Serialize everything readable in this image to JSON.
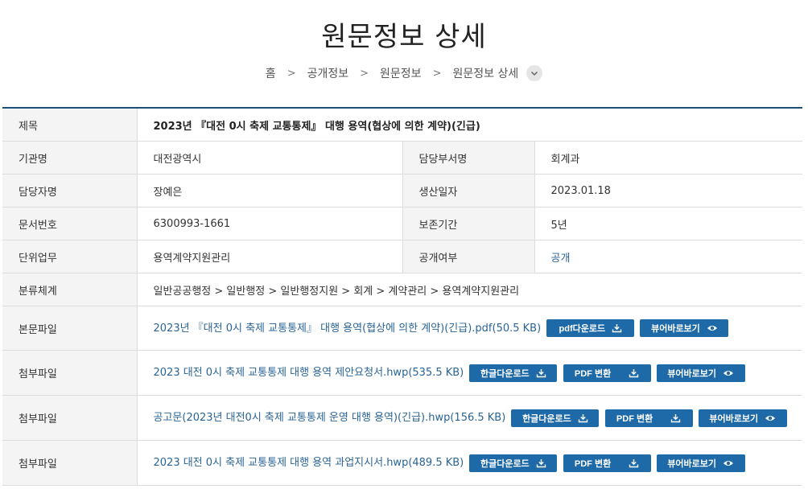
{
  "page": {
    "title": "원문정보 상세"
  },
  "breadcrumb": {
    "items": [
      "홈",
      "공개정보",
      "원문정보",
      "원문정보 상세"
    ],
    "separator": ">"
  },
  "detail": {
    "title_label": "제목",
    "title_value": "2023년 『대전 0시 축제 교통통제』 대행 용역(협상에 의한 계약)(긴급)",
    "rows": [
      {
        "label1": "기관명",
        "value1": "대전광역시",
        "label2": "담당부서명",
        "value2": "회계과"
      },
      {
        "label1": "담당자명",
        "value1": "장예은",
        "label2": "생산일자",
        "value2": "2023.01.18"
      },
      {
        "label1": "문서번호",
        "value1": "6300993-1661",
        "label2": "보존기간",
        "value2": "5년"
      },
      {
        "label1": "단위업무",
        "value1": "용역계약지원관리",
        "label2": "공개여부",
        "value2": "공개"
      }
    ],
    "classification_label": "분류체계",
    "classification_value": "일반공공행정 > 일반행정 > 일반행정지원 > 회계 > 계약관리 > 용역계약지원관리",
    "body_file": {
      "label": "본문파일",
      "name": "2023년 『대전 0시 축제 교통통제』 대행 용역(협상에 의한 계약)(긴급).pdf(50.5 KB)",
      "download_label": "pdf다운로드",
      "view_label": "뷰어바로보기"
    },
    "attachments": [
      {
        "label": "첨부파일",
        "name": "2023 대전 0시 축제 교통통제 대행 용역 제안요청서.hwp(535.5 KB)",
        "download_label": "한글다운로드",
        "convert_label": "PDF 변환",
        "view_label": "뷰어바로보기"
      },
      {
        "label": "첨부파일",
        "name": "공고문(2023년 대전0시 축제 교통통제 운영 대행 용역)(긴급).hwp(156.5 KB)",
        "download_label": "한글다운로드",
        "convert_label": "PDF 변환",
        "view_label": "뷰어바로보기"
      },
      {
        "label": "첨부파일",
        "name": "2023 대전 0시 축제 교통통제 대행 용역 과업지시서.hwp(489.5 KB)",
        "download_label": "한글다운로드",
        "convert_label": "PDF 변환",
        "view_label": "뷰어바로보기"
      }
    ]
  },
  "colors": {
    "accent": "#1e6aa8",
    "link": "#2a6496",
    "header_bg": "#f4f4f4",
    "top_border": "#1a4f7a"
  }
}
